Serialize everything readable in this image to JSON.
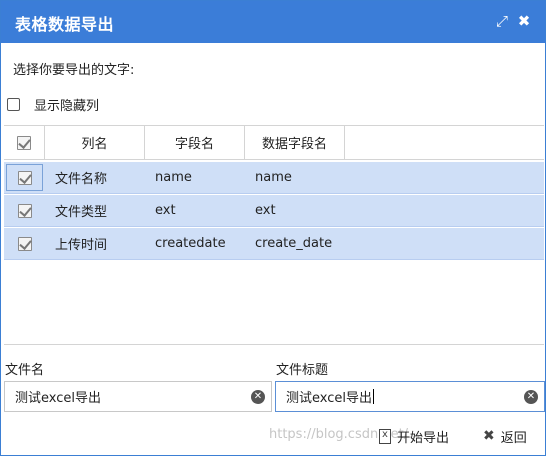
{
  "dialog": {
    "title": "表格数据导出",
    "maximize_icon": "expand-icon",
    "close_icon": "close-icon"
  },
  "prompt": "选择你要导出的文字:",
  "show_hidden": {
    "label": "显示隐藏列",
    "checked": false
  },
  "grid": {
    "headers": [
      "列名",
      "字段名",
      "数据字段名"
    ],
    "rows": [
      {
        "checked": true,
        "name": "文件名称",
        "field": "name",
        "data_field": "name"
      },
      {
        "checked": true,
        "name": "文件类型",
        "field": "ext",
        "data_field": "ext"
      },
      {
        "checked": true,
        "name": "上传时间",
        "field": "createdate",
        "data_field": "create_date"
      }
    ]
  },
  "form": {
    "file_name_label": "文件名",
    "file_name_value": "测试excel导出",
    "file_title_label": "文件标题",
    "file_title_value": "测试excel导出"
  },
  "buttons": {
    "export": "开始导出",
    "back": "返回"
  },
  "watermark": "https://blog.csdn.net/...",
  "colors": {
    "titlebar": "#3b7dd8",
    "row_selected": "#cfdff7"
  }
}
